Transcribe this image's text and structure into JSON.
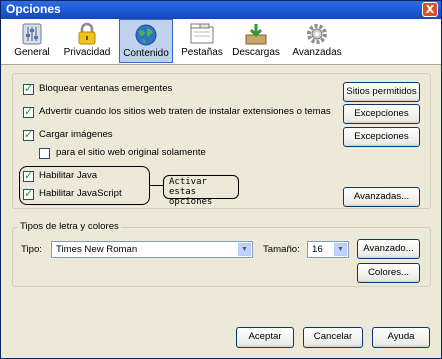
{
  "window": {
    "title": "Opciones",
    "close_label": "X"
  },
  "tabs": [
    {
      "label": "General",
      "icon": "general-icon"
    },
    {
      "label": "Privacidad",
      "icon": "lock-icon"
    },
    {
      "label": "Contenido",
      "icon": "globe-icon",
      "selected": true
    },
    {
      "label": "Pestañas",
      "icon": "tabs-icon"
    },
    {
      "label": "Descargas",
      "icon": "downloads-icon"
    },
    {
      "label": "Avanzadas",
      "icon": "gear-icon"
    }
  ],
  "content": {
    "block_popups": {
      "label": "Bloquear ventanas emergentes",
      "checked": true
    },
    "warn_extensions": {
      "label": "Advertir cuando los sitios web traten de instalar extensiones o temas",
      "checked": true
    },
    "load_images": {
      "label": "Cargar imágenes",
      "checked": true
    },
    "original_site_only": {
      "label": "para el sitio web original solamente",
      "checked": false
    },
    "enable_java": {
      "label": "Habilitar Java",
      "checked": true
    },
    "enable_javascript": {
      "label": "Habilitar JavaScript",
      "checked": true
    },
    "allowed_sites_button": "Sitios permitidos",
    "exceptions_button_1": "Excepciones",
    "exceptions_button_2": "Excepciones",
    "advanced_button": "Avanzadas...",
    "annotation": "Activar estas opciones"
  },
  "fonts": {
    "legend": "Tipos de letra y colores",
    "type_label": "Tipo:",
    "type_value": "Times New Roman",
    "size_label": "Tamaño:",
    "size_value": "16",
    "advanced_button": "Avanzado...",
    "colors_button": "Colores..."
  },
  "footer": {
    "ok": "Aceptar",
    "cancel": "Cancelar",
    "help": "Ayuda"
  },
  "colors": {
    "titlebar": "#1c55d3",
    "dialog_bg": "#ece9d8",
    "selected_tab_bg": "#c1d2ee",
    "check_mark": "#21a121"
  }
}
